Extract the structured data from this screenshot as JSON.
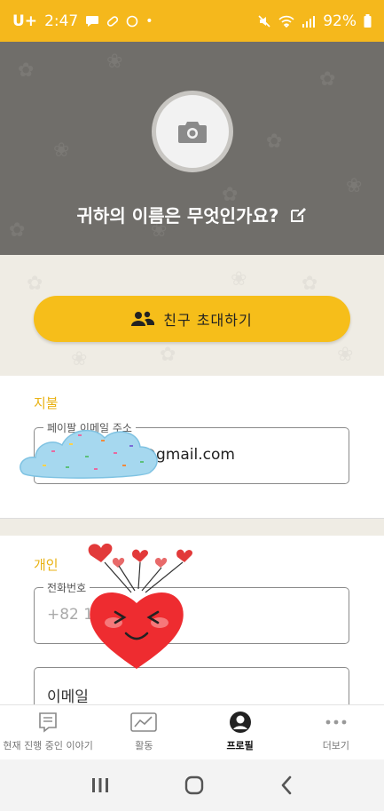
{
  "status_bar": {
    "carrier": "U+",
    "time": "2:47",
    "dot": "•",
    "battery": "92%"
  },
  "header": {
    "name_prompt": "귀하의 이름은 무엇인가요?"
  },
  "invite": {
    "label": "친구 초대하기"
  },
  "payment": {
    "title": "지불",
    "paypal_label": "페이팔 이메일 주소",
    "paypal_value": "@gmail.com"
  },
  "personal": {
    "title": "개인",
    "phone_label": "전화번호",
    "phone_value": "+82 1",
    "email_label": "이메일"
  },
  "bottom_nav": {
    "items": [
      {
        "label": "현재 진행 중인 이야기",
        "icon": "chat-story-icon"
      },
      {
        "label": "활동",
        "icon": "activity-chart-icon"
      },
      {
        "label": "프로필",
        "icon": "profile-icon"
      },
      {
        "label": "더보기",
        "icon": "more-dots-icon"
      }
    ],
    "active_index": 2
  },
  "colors": {
    "accent": "#f5b81c",
    "header_bg": "#706e6a",
    "section_title": "#e9b213"
  }
}
